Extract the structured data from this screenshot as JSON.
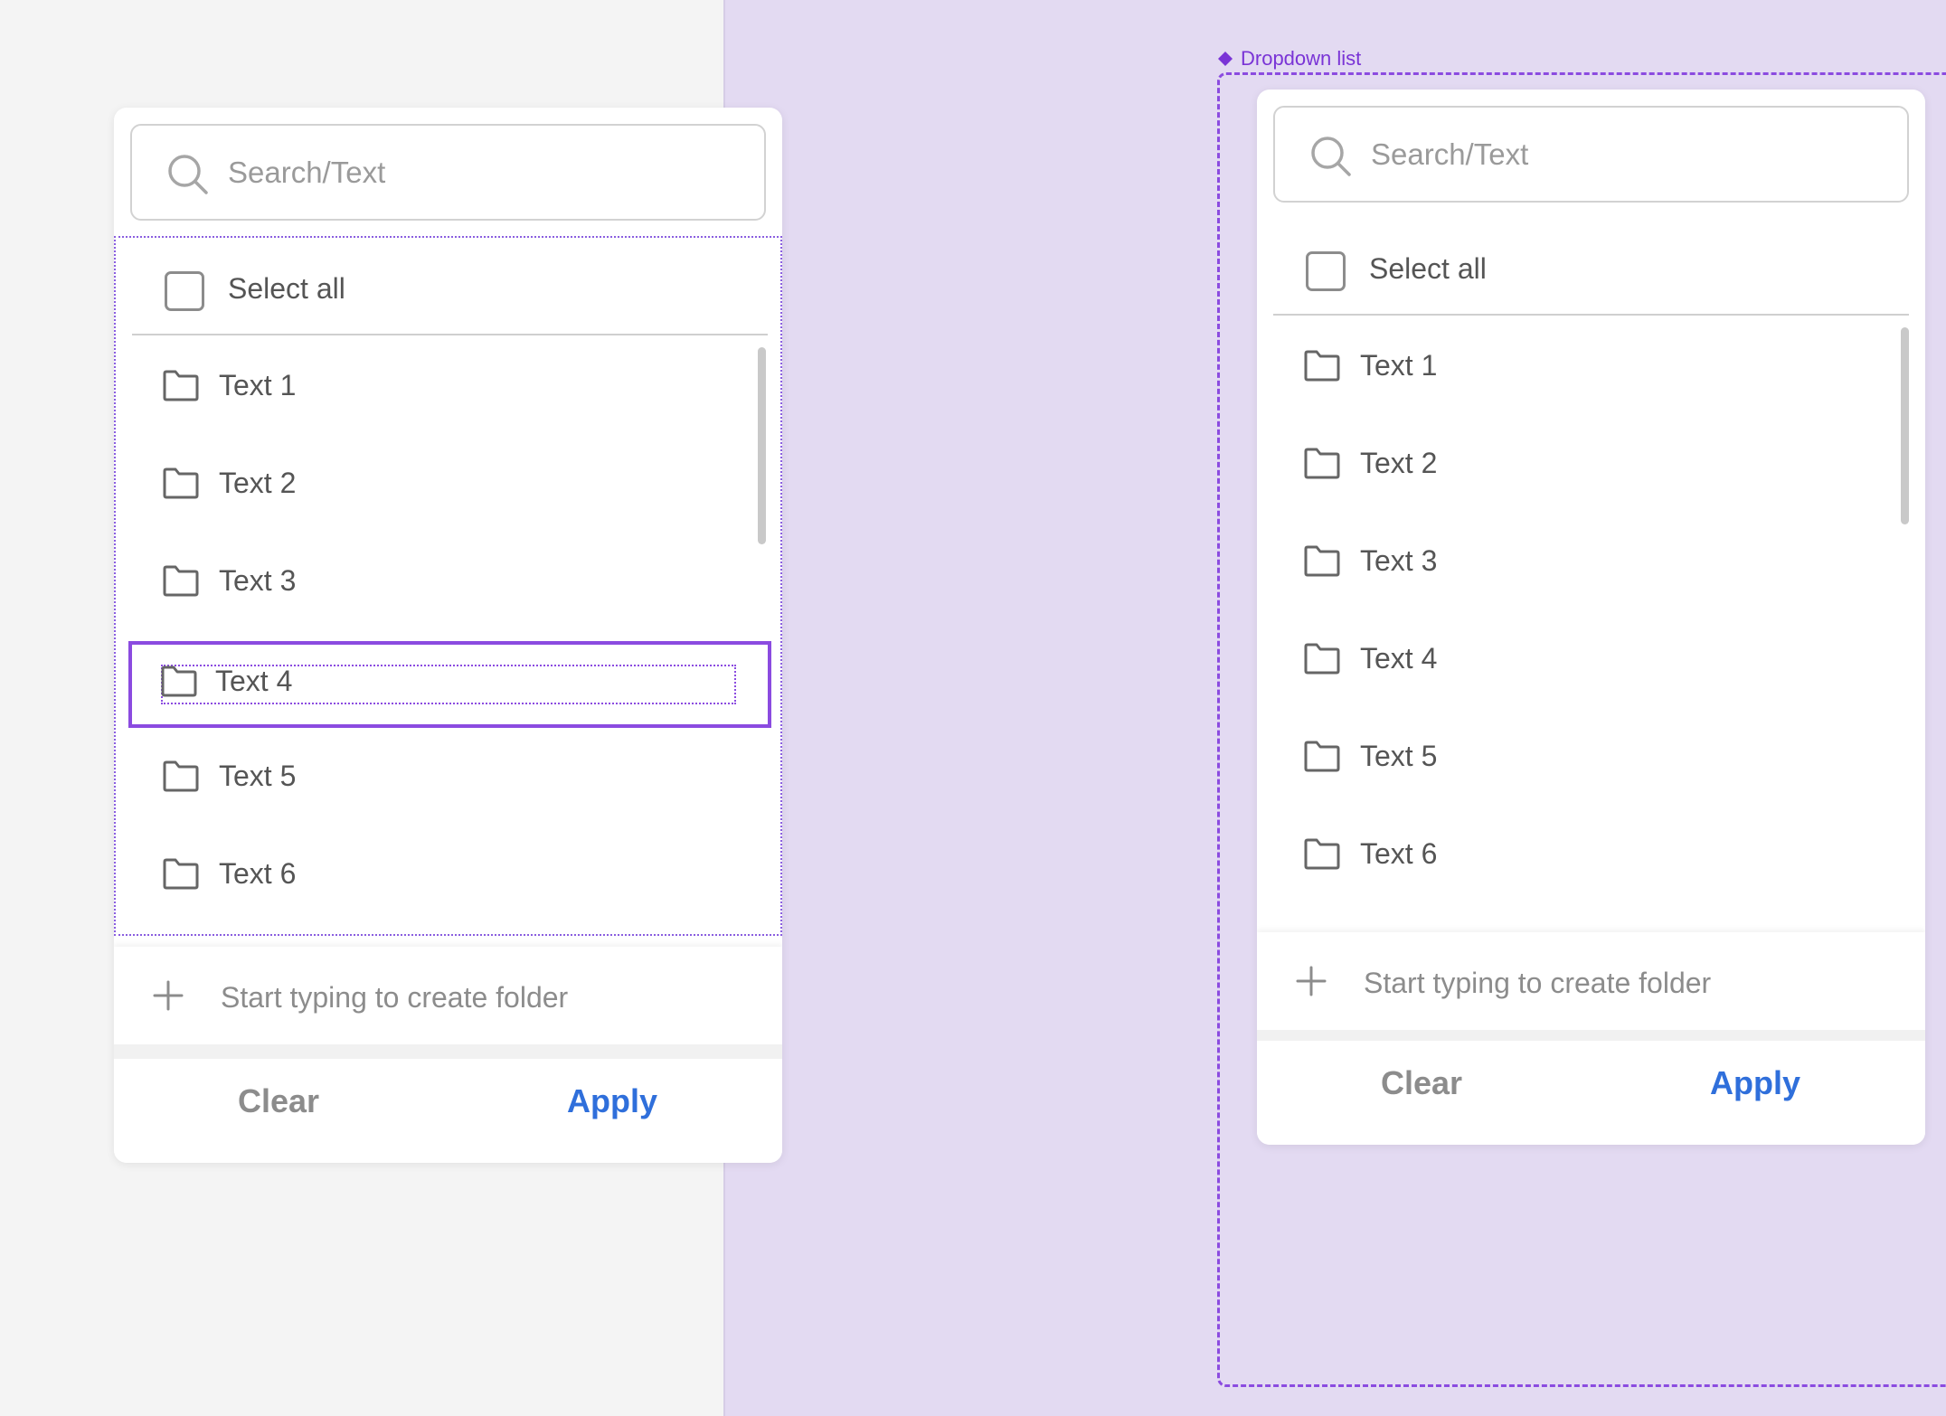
{
  "component_label": "Dropdown list",
  "colors": {
    "accent_purple": "#8b4be0",
    "apply_blue": "#2f6fdb",
    "canvas_purple": "#e3daf2",
    "canvas_gray": "#f4f4f4"
  },
  "dropdowns": [
    {
      "search": {
        "placeholder": "Search/Text",
        "icon": "search-icon"
      },
      "select_all_label": "Select all",
      "items": [
        {
          "label": "Text 1",
          "icon": "folder-icon"
        },
        {
          "label": "Text 2",
          "icon": "folder-icon"
        },
        {
          "label": "Text 3",
          "icon": "folder-icon"
        },
        {
          "label": "Text 4",
          "icon": "folder-icon"
        },
        {
          "label": "Text 5",
          "icon": "folder-icon"
        },
        {
          "label": "Text 6",
          "icon": "folder-icon"
        }
      ],
      "selected_item": "Text 4",
      "create_placeholder": "Start typing to create folder",
      "clear_label": "Clear",
      "apply_label": "Apply"
    },
    {
      "search": {
        "placeholder": "Search/Text",
        "icon": "search-icon"
      },
      "select_all_label": "Select all",
      "items": [
        {
          "label": "Text 1",
          "icon": "folder-icon"
        },
        {
          "label": "Text 2",
          "icon": "folder-icon"
        },
        {
          "label": "Text 3",
          "icon": "folder-icon"
        },
        {
          "label": "Text 4",
          "icon": "folder-icon"
        },
        {
          "label": "Text 5",
          "icon": "folder-icon"
        },
        {
          "label": "Text 6",
          "icon": "folder-icon"
        }
      ],
      "create_placeholder": "Start typing to create folder",
      "clear_label": "Clear",
      "apply_label": "Apply"
    }
  ]
}
